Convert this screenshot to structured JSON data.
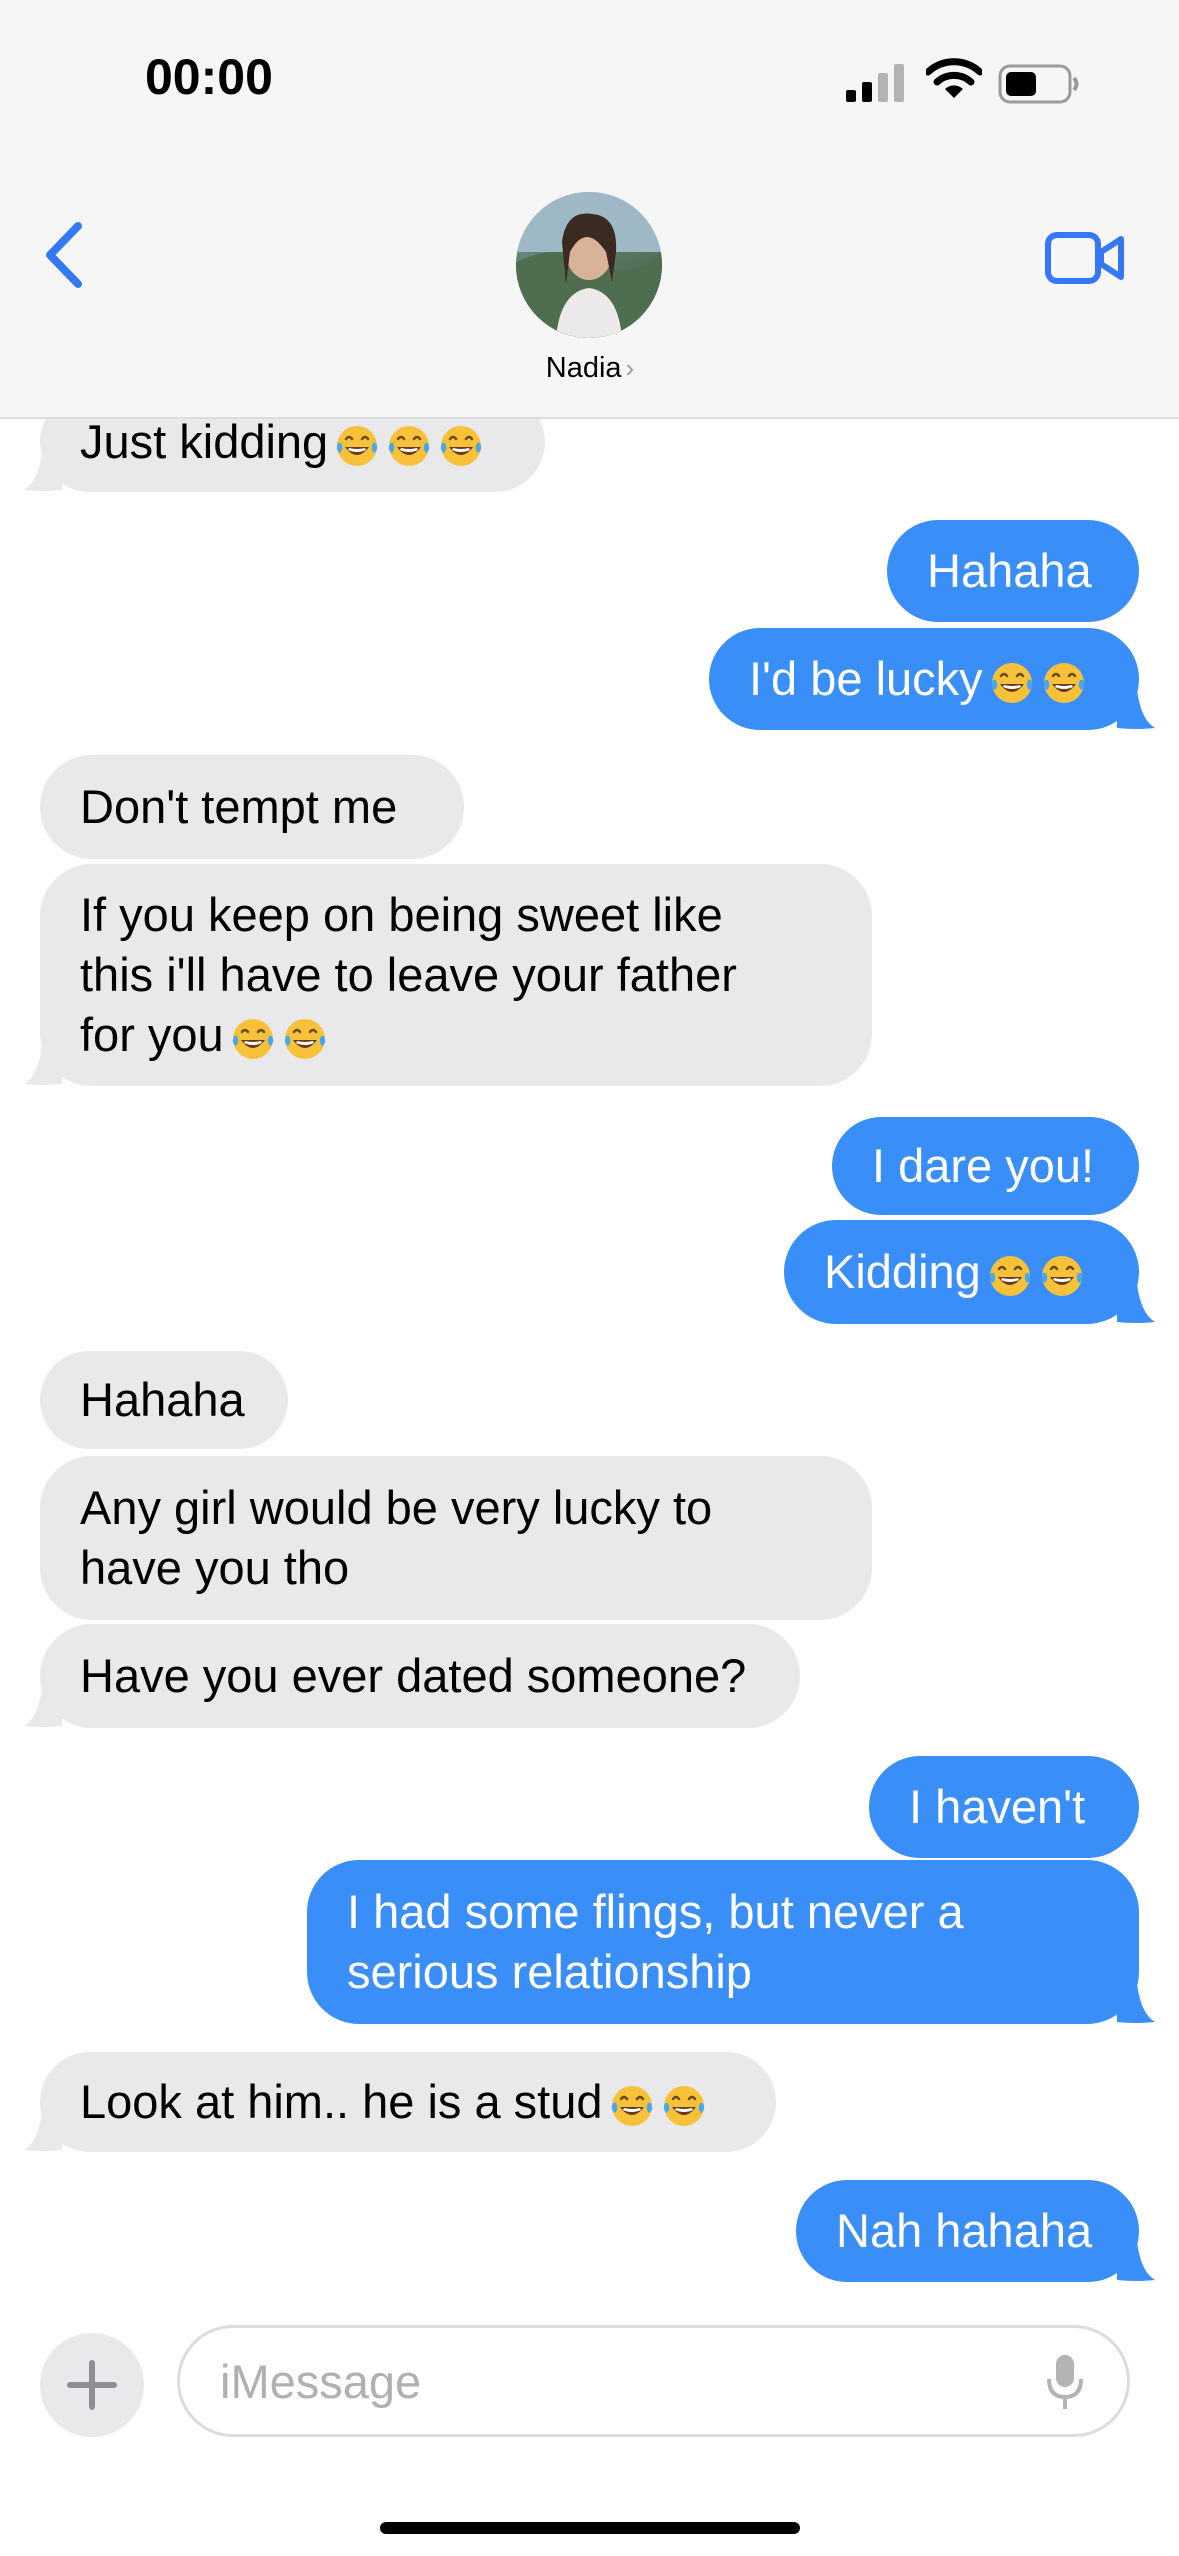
{
  "status_bar": {
    "time": "00:00",
    "icons": [
      "signal-icon",
      "wifi-icon",
      "battery-icon"
    ]
  },
  "header": {
    "contact_name": "Nadia",
    "icons": [
      "back-chevron-icon",
      "video-call-icon",
      "chevron-right-icon"
    ]
  },
  "messages": [
    {
      "side": "in",
      "text": "Just kidding",
      "emoji": 3
    },
    {
      "side": "out",
      "text": "Hahaha",
      "emoji": 0
    },
    {
      "side": "out",
      "text": "I'd be lucky",
      "emoji": 2
    },
    {
      "side": "in",
      "text": "Don't tempt me",
      "emoji": 0
    },
    {
      "side": "in",
      "text": "If you keep on being sweet like\nthis i'll have to leave your father\nfor you",
      "emoji": 2
    },
    {
      "side": "out",
      "text": "I dare you!",
      "emoji": 0
    },
    {
      "side": "out",
      "text": "Kidding",
      "emoji": 2
    },
    {
      "side": "in",
      "text": "Hahaha",
      "emoji": 0
    },
    {
      "side": "in",
      "text": "Any girl would be very lucky to\nhave you tho",
      "emoji": 0
    },
    {
      "side": "in",
      "text": "Have you ever dated someone?",
      "emoji": 0
    },
    {
      "side": "out",
      "text": "I haven't",
      "emoji": 0
    },
    {
      "side": "out",
      "text": "I had some flings, but never a\nserious relationship",
      "emoji": 0
    },
    {
      "side": "in",
      "text": "Look at him.. he is a stud",
      "emoji": 2
    },
    {
      "side": "out",
      "text": "Nah hahaha",
      "emoji": 0
    }
  ],
  "composer": {
    "placeholder": "iMessage",
    "icons": [
      "plus-icon",
      "microphone-icon"
    ]
  },
  "colors": {
    "outgoing": "#3a8ef8",
    "incoming": "#e9e9eb",
    "accent": "#3478f6"
  }
}
